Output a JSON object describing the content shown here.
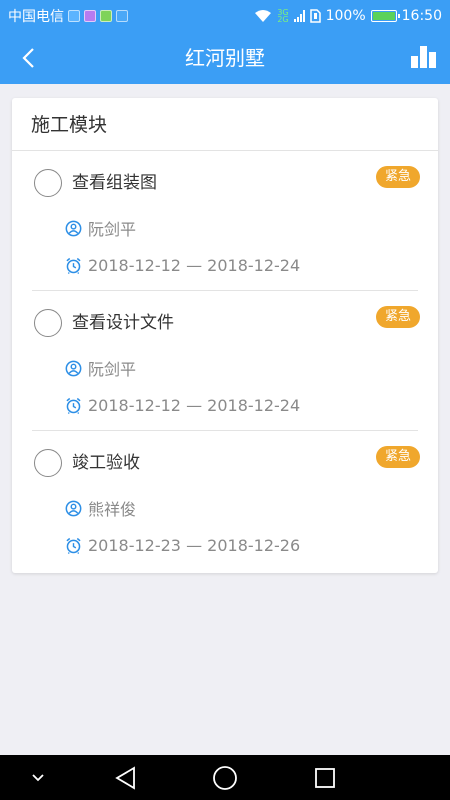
{
  "status_bar": {
    "carrier": "中国电信",
    "battery": "100%",
    "time": "16:50",
    "network_top": "3G",
    "network_bottom": "2G"
  },
  "header": {
    "title": "红河别墅",
    "back_icon": "back-chevron-icon",
    "action_icon": "bar-chart-icon"
  },
  "section": {
    "title": "施工模块"
  },
  "tasks": [
    {
      "name": "查看组装图",
      "badge": "紧急",
      "person": "阮剑平",
      "date_range": "2018-12-12 — 2018-12-24"
    },
    {
      "name": "查看设计文件",
      "badge": "紧急",
      "person": "阮剑平",
      "date_range": "2018-12-12 — 2018-12-24"
    },
    {
      "name": "竣工验收",
      "badge": "紧急",
      "person": "熊祥俊",
      "date_range": "2018-12-23 — 2018-12-26"
    }
  ],
  "colors": {
    "primary": "#3b9ef5",
    "badge": "#f0a72c",
    "icon": "#2d8fe6",
    "background": "#efeff4"
  }
}
